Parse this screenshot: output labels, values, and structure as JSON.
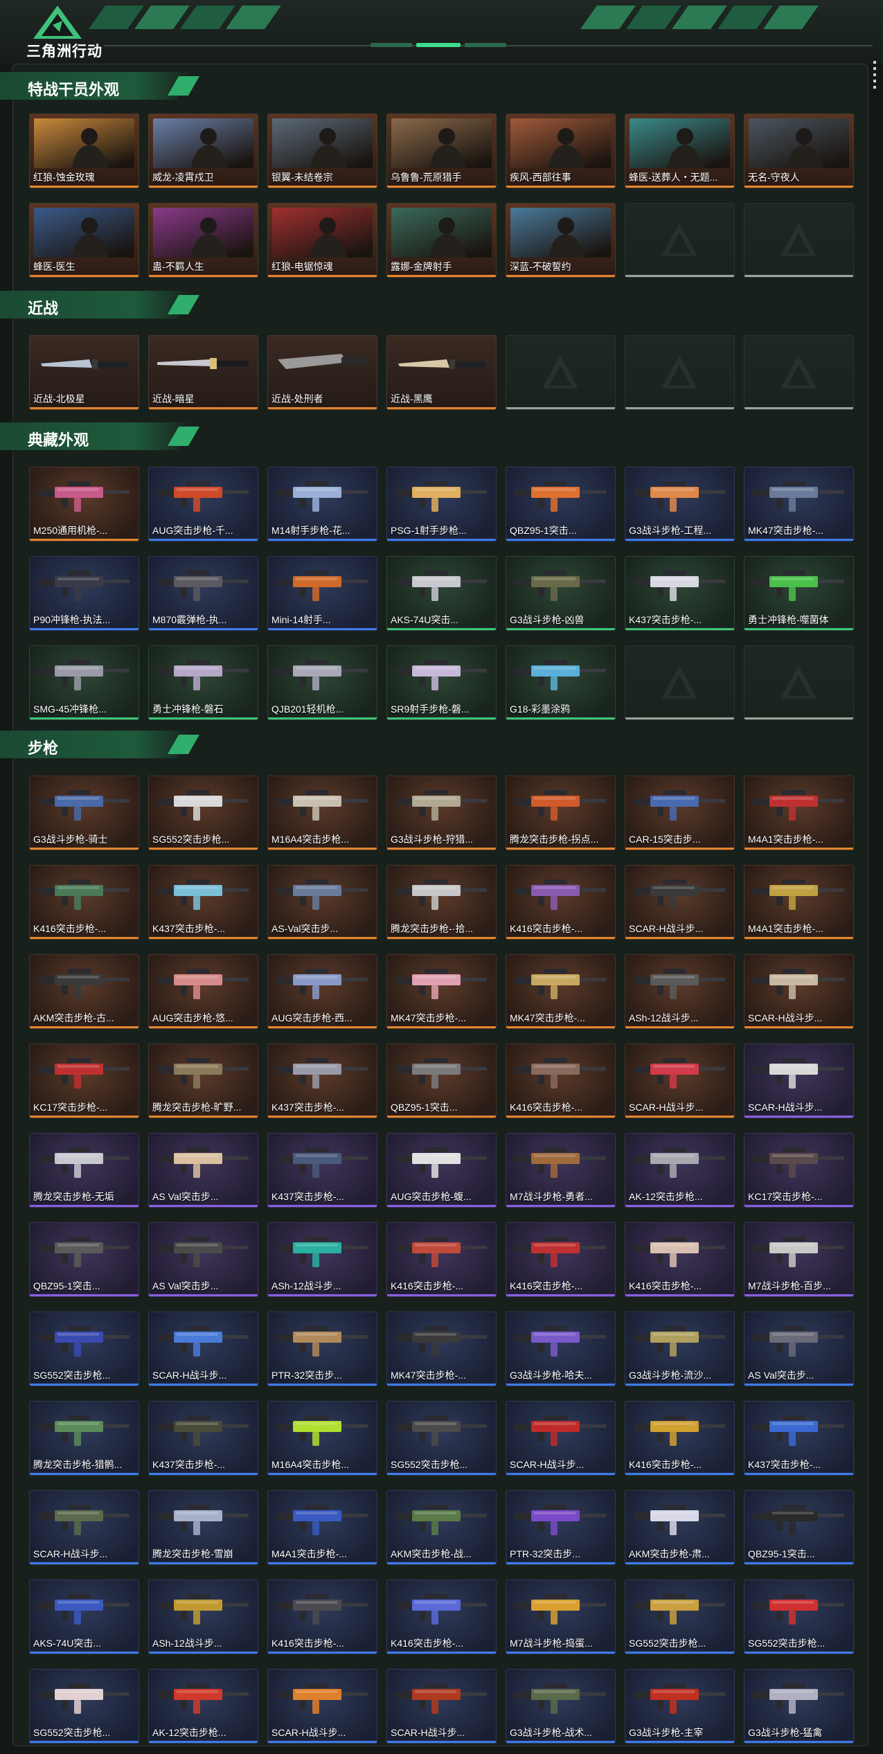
{
  "app": {
    "logo_text": "三角洲行动"
  },
  "colors": {
    "orange": "#e3852e",
    "purple": "#8a5fe0",
    "blue": "#3d7be8",
    "green": "#3fc27a",
    "accent": "#3fdc8c"
  },
  "sections": [
    {
      "title": "特战干员外观",
      "kind": "operator",
      "items": [
        {
          "label": "红狼-蚀金玫瑰",
          "rarity": "orange",
          "tag": "蚀金玫瑰",
          "tone": "#c98a3c"
        },
        {
          "label": "威龙-凌霄戍卫",
          "rarity": "orange",
          "tag": "凌霄戍卫",
          "tone": "#6a7fa8"
        },
        {
          "label": "银翼-未结卷宗",
          "rarity": "orange",
          "tag": "未结卷宗",
          "tone": "#5b6a78"
        },
        {
          "label": "乌鲁鲁-荒原猎手",
          "rarity": "orange",
          "tag": "荒原猎手",
          "tone": "#8a6a4a"
        },
        {
          "label": "疾风-西部往事",
          "rarity": "orange",
          "tag": "西部往事",
          "tone": "#a05a3a"
        },
        {
          "label": "蜂医-送葬人・无题...",
          "rarity": "orange",
          "tag": "送葬人",
          "tone": "#3a8a8a"
        },
        {
          "label": "无名-守夜人",
          "rarity": "orange",
          "tag": "守夜人",
          "tone": "#4a5560"
        },
        {
          "label": "蜂医-医生",
          "rarity": "orange",
          "tag": "医生",
          "tone": "#3a5a8a"
        },
        {
          "label": "蛊-不羁人生",
          "rarity": "orange",
          "tag": "不羁人生",
          "tone": "#8a3a8a"
        },
        {
          "label": "红狼-电锯惊魂",
          "rarity": "orange",
          "tag": "电锯惊魂",
          "tone": "#a03030"
        },
        {
          "label": "露娜-金牌射手",
          "rarity": "orange",
          "tag": "金牌射手",
          "tone": "#3a6a5a"
        },
        {
          "label": "深蓝-不破誓约",
          "rarity": "orange",
          "tag": "不破誓约",
          "tone": "#4a7a9a"
        },
        {
          "label": "",
          "rarity": "empty"
        },
        {
          "label": "",
          "rarity": "empty"
        }
      ]
    },
    {
      "title": "近战",
      "kind": "melee",
      "items": [
        {
          "label": "近战-北极星",
          "rarity": "orange",
          "shape": "knife",
          "color": "#b8c4d4"
        },
        {
          "label": "近战-暗星",
          "rarity": "orange",
          "shape": "blade",
          "color": "#d8c07a"
        },
        {
          "label": "近战-处刑者",
          "rarity": "orange",
          "shape": "saw",
          "color": "#9a9a9a"
        },
        {
          "label": "近战-黑鹰",
          "rarity": "orange",
          "shape": "knife",
          "color": "#d8c8a8"
        },
        {
          "label": "",
          "rarity": "empty"
        },
        {
          "label": "",
          "rarity": "empty"
        },
        {
          "label": "",
          "rarity": "empty"
        }
      ]
    },
    {
      "title": "典藏外观",
      "kind": "weapon",
      "items": [
        {
          "label": "M250通用机枪-...",
          "rarity": "orange",
          "color": "#c85a8a"
        },
        {
          "label": "AUG突击步枪-千...",
          "rarity": "blue",
          "color": "#d04a2a"
        },
        {
          "label": "M14射手步枪-花...",
          "rarity": "blue",
          "color": "#9ab0d8"
        },
        {
          "label": "PSG-1射手步枪...",
          "rarity": "blue",
          "color": "#e0b060"
        },
        {
          "label": "QBZ95-1突击...",
          "rarity": "blue",
          "color": "#e07030"
        },
        {
          "label": "G3战斗步枪-工程...",
          "rarity": "blue",
          "color": "#e0884a"
        },
        {
          "label": "MK47突击步枪-...",
          "rarity": "blue",
          "color": "#6a7a9a"
        },
        {
          "label": "P90冲锋枪-执法...",
          "rarity": "blue",
          "color": "#3a3a48"
        },
        {
          "label": "M870霰弹枪-执...",
          "rarity": "blue",
          "color": "#5a5a60"
        },
        {
          "label": "Mini-14射手...",
          "rarity": "blue",
          "color": "#d06a2a"
        },
        {
          "label": "AKS-74U突击...",
          "rarity": "green",
          "color": "#c8c8d0"
        },
        {
          "label": "G3战斗步枪-凶兽",
          "rarity": "green",
          "color": "#6a6a4a"
        },
        {
          "label": "K437突击步枪-...",
          "rarity": "green",
          "color": "#d8d8e0"
        },
        {
          "label": "勇士冲锋枪-噬菌体",
          "rarity": "green",
          "color": "#4ac04a"
        },
        {
          "label": "SMG-45冲锋枪...",
          "rarity": "green",
          "color": "#9a9aa8"
        },
        {
          "label": "勇士冲锋枪-磐石",
          "rarity": "green",
          "color": "#b8a8c8"
        },
        {
          "label": "QJB201轻机枪...",
          "rarity": "green",
          "color": "#a8a8b8"
        },
        {
          "label": "SR9射手步枪-磐...",
          "rarity": "green",
          "color": "#c8b8d8"
        },
        {
          "label": "G18-彩墨涂鸦",
          "rarity": "green",
          "color": "#5ab0d8"
        },
        {
          "label": "",
          "rarity": "empty"
        },
        {
          "label": "",
          "rarity": "empty"
        }
      ]
    },
    {
      "title": "步枪",
      "kind": "weapon",
      "items": [
        {
          "label": "G3战斗步枪-骑士",
          "rarity": "orange",
          "color": "#4a6aa8"
        },
        {
          "label": "SG552突击步枪...",
          "rarity": "orange",
          "color": "#d8d8d8"
        },
        {
          "label": "M16A4突击步枪...",
          "rarity": "orange",
          "color": "#c8c0b0"
        },
        {
          "label": "G3战斗步枪-狩猎...",
          "rarity": "orange",
          "color": "#b0a890"
        },
        {
          "label": "腾龙突击步枪-拐点...",
          "rarity": "orange",
          "color": "#d05a2a"
        },
        {
          "label": "CAR-15突击步...",
          "rarity": "orange",
          "color": "#4a6ab0"
        },
        {
          "label": "M4A1突击步枪-...",
          "rarity": "orange",
          "color": "#c03030"
        },
        {
          "label": "K416突击步枪-...",
          "rarity": "orange",
          "color": "#4a7a5a"
        },
        {
          "label": "K437突击步枪-...",
          "rarity": "orange",
          "color": "#7ac0d8"
        },
        {
          "label": "AS-Val突击步...",
          "rarity": "orange",
          "color": "#6a7a9a"
        },
        {
          "label": "腾龙突击步枪-·拾...",
          "rarity": "orange",
          "color": "#c8c8c8"
        },
        {
          "label": "K416突击步枪-...",
          "rarity": "orange",
          "color": "#8a5ab0"
        },
        {
          "label": "SCAR-H战斗步...",
          "rarity": "orange",
          "color": "#3a3a3a"
        },
        {
          "label": "M4A1突击步枪-...",
          "rarity": "orange",
          "color": "#c0a040"
        },
        {
          "label": "AKM突击步枪-古...",
          "rarity": "orange",
          "color": "#3a3a3a"
        },
        {
          "label": "AUG突击步枪-悠...",
          "rarity": "orange",
          "color": "#d88a8a"
        },
        {
          "label": "AUG突击步枪-西...",
          "rarity": "orange",
          "color": "#8a9ac8"
        },
        {
          "label": "MK47突击步枪-...",
          "rarity": "orange",
          "color": "#e0a0b0"
        },
        {
          "label": "MK47突击步枪-...",
          "rarity": "orange",
          "color": "#c8a860"
        },
        {
          "label": "ASh-12战斗步...",
          "rarity": "orange",
          "color": "#5a5a5a"
        },
        {
          "label": "SCAR-H战斗步...",
          "rarity": "orange",
          "color": "#c8b8a0"
        },
        {
          "label": "KC17突击步枪-...",
          "rarity": "orange",
          "color": "#c03030"
        },
        {
          "label": "腾龙突击步枪-旷野...",
          "rarity": "orange",
          "color": "#8a7a5a"
        },
        {
          "label": "K437突击步枪-...",
          "rarity": "orange",
          "color": "#9a9aa8"
        },
        {
          "label": "QBZ95-1突击...",
          "rarity": "orange",
          "color": "#7a7a7a"
        },
        {
          "label": "K416突击步枪-...",
          "rarity": "orange",
          "color": "#8a6a5a"
        },
        {
          "label": "SCAR-H战斗步...",
          "rarity": "orange",
          "color": "#d03a4a"
        },
        {
          "label": "SCAR-H战斗步...",
          "rarity": "purple",
          "color": "#d8d8d8"
        },
        {
          "label": "腾龙突击步枪-无垢",
          "rarity": "purple",
          "color": "#c8c8d0"
        },
        {
          "label": "AS Val突击步...",
          "rarity": "purple",
          "color": "#d8c0a0"
        },
        {
          "label": "K437突击步枪-...",
          "rarity": "purple",
          "color": "#4a5a7a"
        },
        {
          "label": "AUG突击步枪-蝮...",
          "rarity": "purple",
          "color": "#e0e0e0"
        },
        {
          "label": "M7战斗步枪-勇者...",
          "rarity": "purple",
          "color": "#a06a3a"
        },
        {
          "label": "AK-12突击步枪...",
          "rarity": "purple",
          "color": "#a8a8b0"
        },
        {
          "label": "KC17突击步枪-...",
          "rarity": "purple",
          "color": "#5a4a4a"
        },
        {
          "label": "QBZ95-1突击...",
          "rarity": "purple",
          "color": "#5a5a5a"
        },
        {
          "label": "AS Val突击步...",
          "rarity": "purple",
          "color": "#4a4a4a"
        },
        {
          "label": "ASh-12战斗步...",
          "rarity": "purple",
          "color": "#2ab0a0"
        },
        {
          "label": "K416突击步枪-...",
          "rarity": "purple",
          "color": "#c04a3a"
        },
        {
          "label": "K416突击步枪-...",
          "rarity": "purple",
          "color": "#c03030"
        },
        {
          "label": "K416突击步枪-...",
          "rarity": "purple",
          "color": "#d8c0b0"
        },
        {
          "label": "M7战斗步枪-百步...",
          "rarity": "purple",
          "color": "#c8c8c8"
        },
        {
          "label": "SG552突击步枪...",
          "rarity": "blue",
          "color": "#3a4ab0"
        },
        {
          "label": "SCAR-H战斗步...",
          "rarity": "blue",
          "color": "#4a7ad8"
        },
        {
          "label": "PTR-32突击步...",
          "rarity": "blue",
          "color": "#b08a5a"
        },
        {
          "label": "MK47突击步枪-...",
          "rarity": "blue",
          "color": "#3a3a3a"
        },
        {
          "label": "G3战斗步枪-哈夫...",
          "rarity": "blue",
          "color": "#7a5ac8"
        },
        {
          "label": "G3战斗步枪-流沙...",
          "rarity": "blue",
          "color": "#b0a060"
        },
        {
          "label": "AS Val突击步...",
          "rarity": "blue",
          "color": "#6a6a78"
        },
        {
          "label": "腾龙突击步枪-猎鹘...",
          "rarity": "blue",
          "color": "#5a8a5a"
        },
        {
          "label": "K437突击步枪-...",
          "rarity": "blue",
          "color": "#4a4a3a"
        },
        {
          "label": "M16A4突击步枪...",
          "rarity": "blue",
          "color": "#b0e030"
        },
        {
          "label": "SG552突击步枪...",
          "rarity": "blue",
          "color": "#4a4a4a"
        },
        {
          "label": "SCAR-H战斗步...",
          "rarity": "blue",
          "color": "#c02a2a"
        },
        {
          "label": "K416突击步枪-...",
          "rarity": "blue",
          "color": "#d0a030"
        },
        {
          "label": "K437突击步枪-...",
          "rarity": "blue",
          "color": "#3a6ad0"
        },
        {
          "label": "SCAR-H战斗步...",
          "rarity": "blue",
          "color": "#5a6a4a"
        },
        {
          "label": "腾龙突击步枪-雪崩",
          "rarity": "blue",
          "color": "#a8b0c8"
        },
        {
          "label": "M4A1突击步枪-...",
          "rarity": "blue",
          "color": "#3a5ac0"
        },
        {
          "label": "AKM突击步枪-战...",
          "rarity": "blue",
          "color": "#5a7a4a"
        },
        {
          "label": "PTR-32突击步...",
          "rarity": "blue",
          "color": "#7a4ac8"
        },
        {
          "label": "AKM突击步枪-肃...",
          "rarity": "blue",
          "color": "#d8d8e8"
        },
        {
          "label": "QBZ95-1突击...",
          "rarity": "blue",
          "color": "#2a2a2a"
        },
        {
          "label": "AKS-74U突击...",
          "rarity": "blue",
          "color": "#3a5ac0"
        },
        {
          "label": "ASh-12战斗步...",
          "rarity": "blue",
          "color": "#c09a30"
        },
        {
          "label": "K416突击步枪-...",
          "rarity": "blue",
          "color": "#4a4a50"
        },
        {
          "label": "K416突击步枪-...",
          "rarity": "blue",
          "color": "#5a6ad8"
        },
        {
          "label": "M7战斗步枪-捣蛋...",
          "rarity": "blue",
          "color": "#d8a030"
        },
        {
          "label": "SG552突击步枪...",
          "rarity": "blue",
          "color": "#c8a040"
        },
        {
          "label": "SG552突击步枪...",
          "rarity": "blue",
          "color": "#d03030"
        },
        {
          "label": "SG552突击步枪...",
          "rarity": "blue",
          "color": "#e0d0d0"
        },
        {
          "label": "AK-12突击步枪...",
          "rarity": "blue",
          "color": "#d03a2a"
        },
        {
          "label": "SCAR-H战斗步...",
          "rarity": "blue",
          "color": "#e0802a"
        },
        {
          "label": "SCAR-H战斗步...",
          "rarity": "blue",
          "color": "#b03a20"
        },
        {
          "label": "G3战斗步枪-战术...",
          "rarity": "blue",
          "color": "#5a6a4a"
        },
        {
          "label": "G3战斗步枪-主宰",
          "rarity": "blue",
          "color": "#c03020"
        },
        {
          "label": "G3战斗步枪-猛禽",
          "rarity": "blue",
          "color": "#b0b0c0"
        }
      ]
    }
  ]
}
